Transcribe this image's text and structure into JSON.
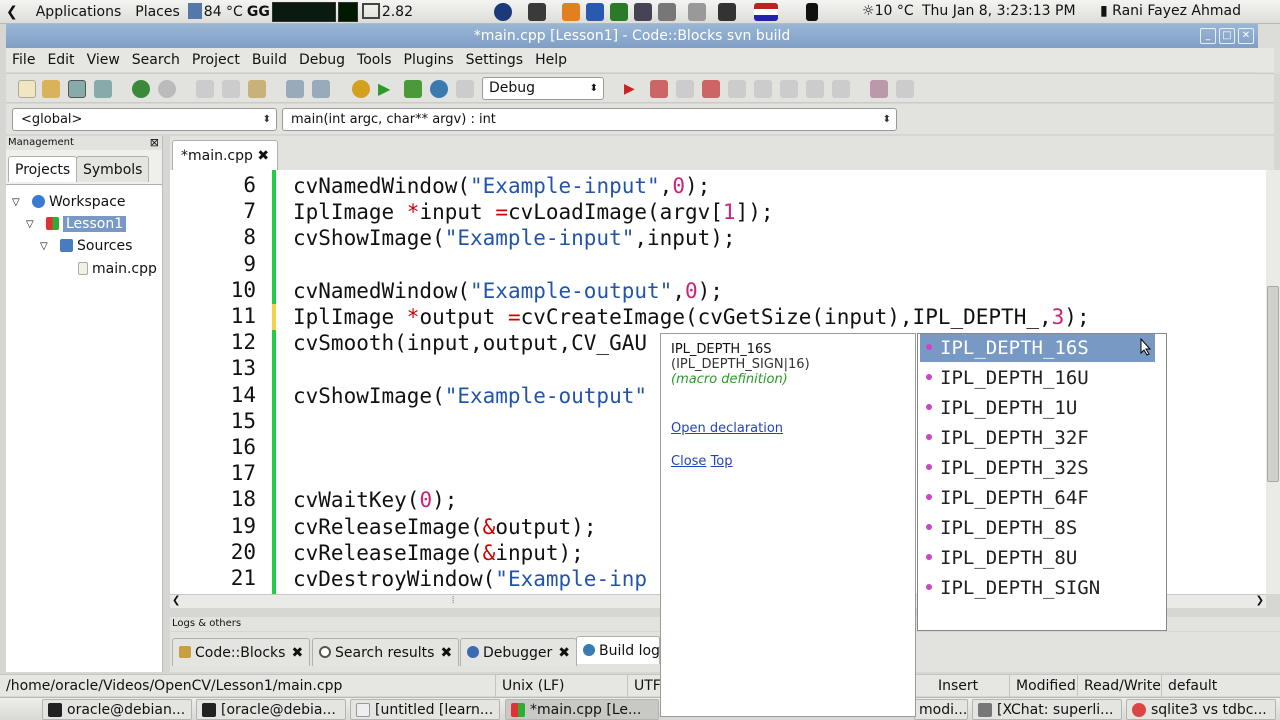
{
  "top_panel": {
    "applications": "Applications",
    "places": "Places",
    "temp_left": "84 °C",
    "cpu_value": "2.82",
    "weather": "10 °C",
    "datetime": "Thu Jan  8,  3:23:13 PM",
    "user": "Rani Fayez Ahmad"
  },
  "window": {
    "title": "*main.cpp [Lesson1] - Code::Blocks svn build"
  },
  "menu": [
    "File",
    "Edit",
    "View",
    "Search",
    "Project",
    "Build",
    "Debug",
    "Tools",
    "Plugins",
    "Settings",
    "Help"
  ],
  "toolbar": {
    "build_target": "Debug"
  },
  "scope": {
    "namespace": "<global>",
    "function": "main(int argc, char** argv) : int"
  },
  "management": {
    "title": "Management",
    "tabs": [
      "Projects",
      "Symbols"
    ],
    "tree": {
      "workspace": "Workspace",
      "project": "Lesson1",
      "folder": "Sources",
      "file": "main.cpp"
    }
  },
  "editor": {
    "tab_label": "*main.cpp",
    "lines": [
      {
        "n": "6",
        "segs": [
          [
            "t",
            "cvNamedWindow("
          ],
          [
            "s",
            "\"Example-input\""
          ],
          [
            "t",
            ","
          ],
          [
            "n",
            "0"
          ],
          [
            "t",
            ");"
          ]
        ]
      },
      {
        "n": "7",
        "segs": [
          [
            "t",
            "IplImage "
          ],
          [
            "o",
            "*"
          ],
          [
            "t",
            "input "
          ],
          [
            "o",
            "="
          ],
          [
            "t",
            "cvLoadImage(argv["
          ],
          [
            "n",
            "1"
          ],
          [
            "t",
            "]);"
          ]
        ]
      },
      {
        "n": "8",
        "segs": [
          [
            "t",
            "cvShowImage("
          ],
          [
            "s",
            "\"Example-input\""
          ],
          [
            "t",
            ",input);"
          ]
        ]
      },
      {
        "n": "9",
        "segs": []
      },
      {
        "n": "10",
        "segs": [
          [
            "t",
            "cvNamedWindow("
          ],
          [
            "s",
            "\"Example-output\""
          ],
          [
            "t",
            ","
          ],
          [
            "n",
            "0"
          ],
          [
            "t",
            ");"
          ]
        ]
      },
      {
        "n": "11",
        "segs": [
          [
            "t",
            "IplImage "
          ],
          [
            "o",
            "*"
          ],
          [
            "t",
            "output "
          ],
          [
            "o",
            "="
          ],
          [
            "t",
            "cvCreateImage(cvGetSize(input),IPL_DEPTH_,"
          ],
          [
            "n",
            "3"
          ],
          [
            "t",
            ");"
          ]
        ]
      },
      {
        "n": "12",
        "segs": [
          [
            "t",
            "cvSmooth(input,output,CV_GAU"
          ]
        ]
      },
      {
        "n": "13",
        "segs": []
      },
      {
        "n": "14",
        "segs": [
          [
            "t",
            "cvShowImage("
          ],
          [
            "s",
            "\"Example-output\""
          ]
        ]
      },
      {
        "n": "15",
        "segs": []
      },
      {
        "n": "16",
        "segs": []
      },
      {
        "n": "17",
        "segs": []
      },
      {
        "n": "18",
        "segs": [
          [
            "t",
            "cvWaitKey("
          ],
          [
            "n",
            "0"
          ],
          [
            "t",
            ");"
          ]
        ]
      },
      {
        "n": "19",
        "segs": [
          [
            "t",
            "cvReleaseImage("
          ],
          [
            "o",
            "&"
          ],
          [
            "t",
            "output);"
          ]
        ]
      },
      {
        "n": "20",
        "segs": [
          [
            "t",
            "cvReleaseImage("
          ],
          [
            "o",
            "&"
          ],
          [
            "t",
            "input);"
          ]
        ]
      },
      {
        "n": "21",
        "segs": [
          [
            "t",
            "cvDestroyWindow("
          ],
          [
            "s",
            "\"Example-inp"
          ]
        ]
      }
    ]
  },
  "tooltip": {
    "name": "IPL_DEPTH_16S",
    "value": "(IPL_DEPTH_SIGN|16)",
    "kind": "(macro definition)",
    "open_declaration": "Open declaration",
    "close": "Close",
    "top": "Top"
  },
  "autocomplete": {
    "items": [
      "IPL_DEPTH_16S",
      "IPL_DEPTH_16U",
      "IPL_DEPTH_1U",
      "IPL_DEPTH_32F",
      "IPL_DEPTH_32S",
      "IPL_DEPTH_64F",
      "IPL_DEPTH_8S",
      "IPL_DEPTH_8U",
      "IPL_DEPTH_SIGN"
    ],
    "selected_index": 0
  },
  "logs": {
    "title": "Logs & others",
    "tabs": [
      "Code::Blocks",
      "Search results",
      "Debugger",
      "Build log"
    ]
  },
  "status": {
    "path": "/home/oracle/Videos/OpenCV/Lesson1/main.cpp",
    "eol": "Unix (LF)",
    "encoding": "UTF",
    "mode": "Insert",
    "modified": "Modified",
    "access": "Read/Write",
    "profile": "default"
  },
  "taskbar": {
    "items": [
      "oracle@debian...",
      "[oracle@debia...",
      "[untitled [learn...",
      "*main.cpp [Le...",
      "modi...",
      "[XChat: superli...",
      "sqlite3 vs tdbc..."
    ]
  },
  "colors": {
    "accent": "#7799c4",
    "change_bar": "#22cc44",
    "string": "#2255aa",
    "number": "#cc2277",
    "operator": "#cc0000"
  }
}
